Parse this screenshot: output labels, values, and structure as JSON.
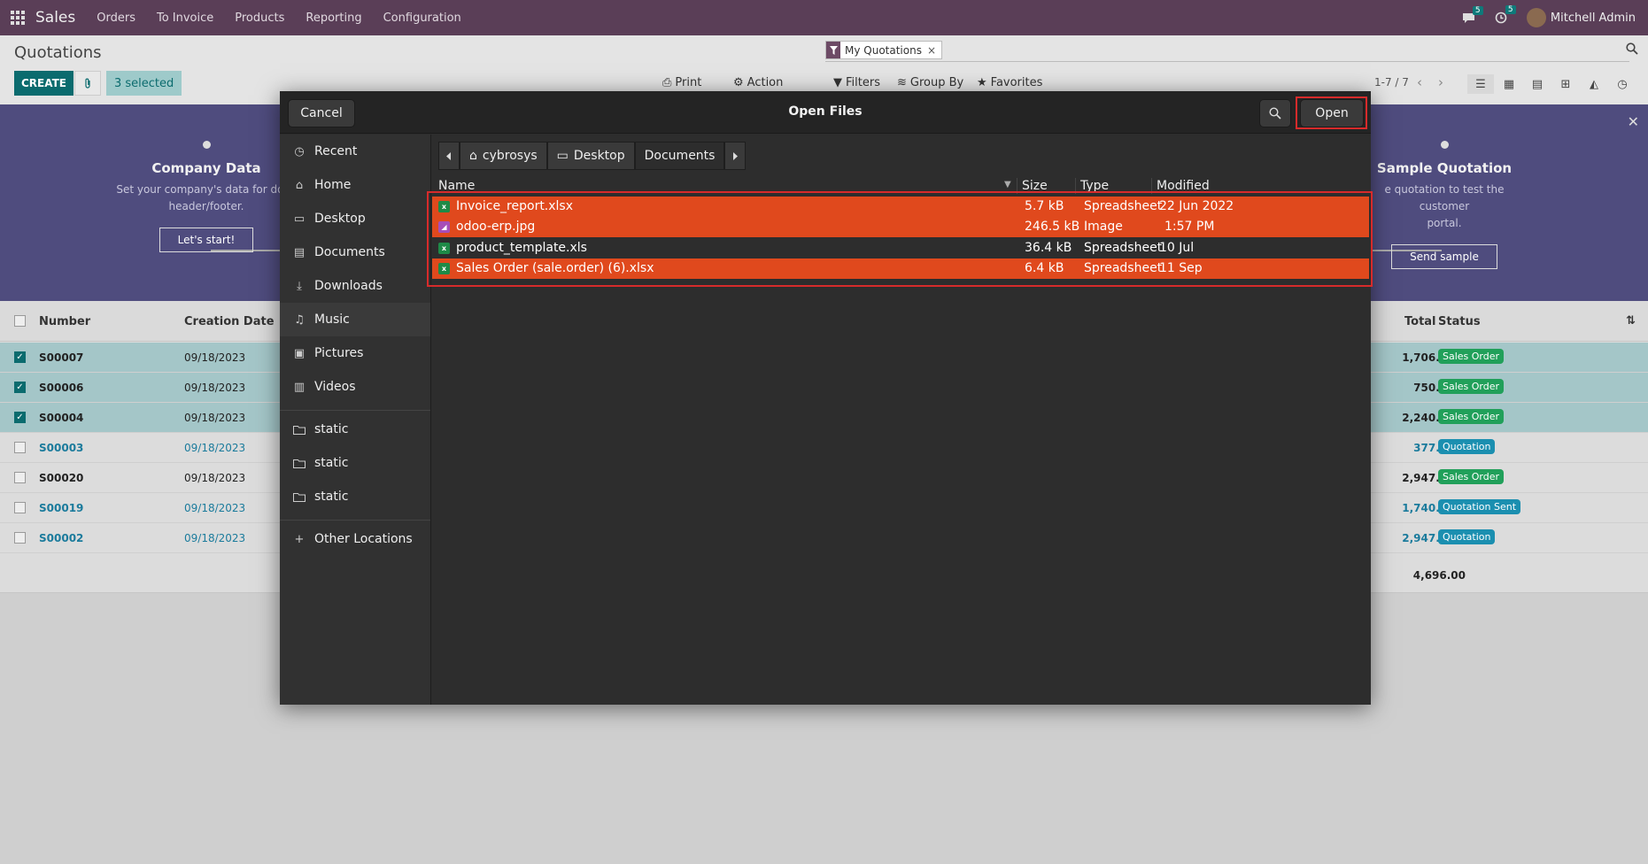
{
  "topbar": {
    "app_name": "Sales",
    "menu": [
      "Orders",
      "To Invoice",
      "Products",
      "Reporting",
      "Configuration"
    ],
    "messages_count": "5",
    "activities_count": "5",
    "user_name": "Mitchell Admin"
  },
  "control_panel": {
    "title": "Quotations",
    "create_label": "CREATE",
    "selected_label": "3 selected",
    "facet_label": "My Quotations",
    "print_label": "Print",
    "action_label": "Action",
    "filters_label": "Filters",
    "groupby_label": "Group By",
    "favorites_label": "Favorites",
    "pager": "1-7 / 7"
  },
  "banner": {
    "step1": {
      "title": "Company Data",
      "desc1": "Set your company's data for docu",
      "desc2": "header/footer.",
      "button": "Let's start!"
    },
    "step4": {
      "title": "Sample Quotation",
      "desc1": "e quotation to test the customer",
      "desc2": "portal.",
      "button": "Send sample"
    }
  },
  "list": {
    "headers": {
      "number": "Number",
      "creation_date": "Creation Date",
      "total": "Total",
      "status": "Status"
    },
    "rows": [
      {
        "number": "S00007",
        "date": "09/18/2023",
        "total": "1,706.00 €",
        "status": "Sales Order"
      },
      {
        "number": "S00006",
        "date": "09/18/2023",
        "total": "750.00 €",
        "status": "Sales Order"
      },
      {
        "number": "S00004",
        "date": "09/18/2023",
        "total": "2,240.00 €",
        "status": "Sales Order"
      },
      {
        "number": "S00003",
        "date": "09/18/2023",
        "total": "377.50 €",
        "status": "Quotation"
      },
      {
        "number": "S00020",
        "date": "09/18/2023",
        "total": "2,947.50 €",
        "status": "Sales Order"
      },
      {
        "number": "S00019",
        "date": "09/18/2023",
        "total": "1,740.00 €",
        "status": "Quotation Sent"
      },
      {
        "number": "S00002",
        "date": "09/18/2023",
        "total": "2,947.50 €",
        "status": "Quotation"
      }
    ],
    "grand_total": "4,696.00"
  },
  "dialog": {
    "title": "Open Files",
    "cancel_label": "Cancel",
    "open_label": "Open",
    "sidebar": [
      "Recent",
      "Home",
      "Desktop",
      "Documents",
      "Downloads",
      "Music",
      "Pictures",
      "Videos"
    ],
    "bookmarks": [
      "static",
      "static",
      "static"
    ],
    "other_locations": "Other Locations",
    "path": [
      "cybrosys",
      "Desktop",
      "Documents"
    ],
    "columns": {
      "name": "Name",
      "size": "Size",
      "type": "Type",
      "modified": "Modified"
    },
    "files": [
      {
        "name": "Invoice_report.xlsx",
        "size": "5.7 kB",
        "type": "Spreadsheet",
        "modified": "22 Jun 2022"
      },
      {
        "name": "odoo-erp.jpg",
        "size": "246.5 kB",
        "type": "Image",
        "modified": "1:57 PM"
      },
      {
        "name": "product_template.xls",
        "size": "36.4 kB",
        "type": "Spreadsheet",
        "modified": "10 Jul"
      },
      {
        "name": "Sales Order (sale.order) (6).xlsx",
        "size": "6.4 kB",
        "type": "Spreadsheet",
        "modified": "11 Sep"
      }
    ]
  },
  "colors": {
    "topbar": "#5a3e57",
    "primary": "#0b6b6e",
    "selection": "#e0491d",
    "highlight_outline": "#d72b2b",
    "badge_sales_order": "#21a05a",
    "badge_quotation": "#1b8fb0"
  }
}
